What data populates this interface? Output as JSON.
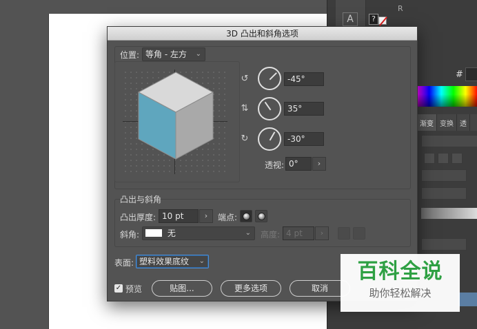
{
  "background": {
    "right_panel": {
      "tool_letter": "A",
      "help_glyph": "?",
      "r_label": "R",
      "hash_label": "#",
      "tabs": [
        "渐变",
        "变换",
        "透"
      ]
    }
  },
  "dialog": {
    "title": "3D 凸出和斜角选项",
    "position": {
      "label": "位置:",
      "value": "等角 - 左方"
    },
    "rotation": {
      "x": {
        "value": "-45°",
        "angle": -45
      },
      "y": {
        "value": "35°",
        "angle": 35
      },
      "z": {
        "value": "-30°",
        "angle": -30
      }
    },
    "perspective": {
      "label": "透视:",
      "value": "0°"
    },
    "extrude_bevel": {
      "section_label": "凸出与斜角",
      "depth_label": "凸出厚度:",
      "depth_value": "10 pt",
      "cap_label": "端点:",
      "bevel_label": "斜角:",
      "bevel_value": "无",
      "height_label": "高度:",
      "height_value": "4 pt"
    },
    "surface": {
      "label": "表面:",
      "value": "塑料效果底纹"
    },
    "preview_label": "预览",
    "buttons": {
      "map": "贴图...",
      "more": "更多选项",
      "cancel": "取消"
    }
  },
  "cube_colors": {
    "top": "#d9d9d9",
    "left": "#5fa6be",
    "right": "#a9a9a9"
  },
  "watermark": {
    "main": "百科全说",
    "sub": "助你轻松解决"
  }
}
